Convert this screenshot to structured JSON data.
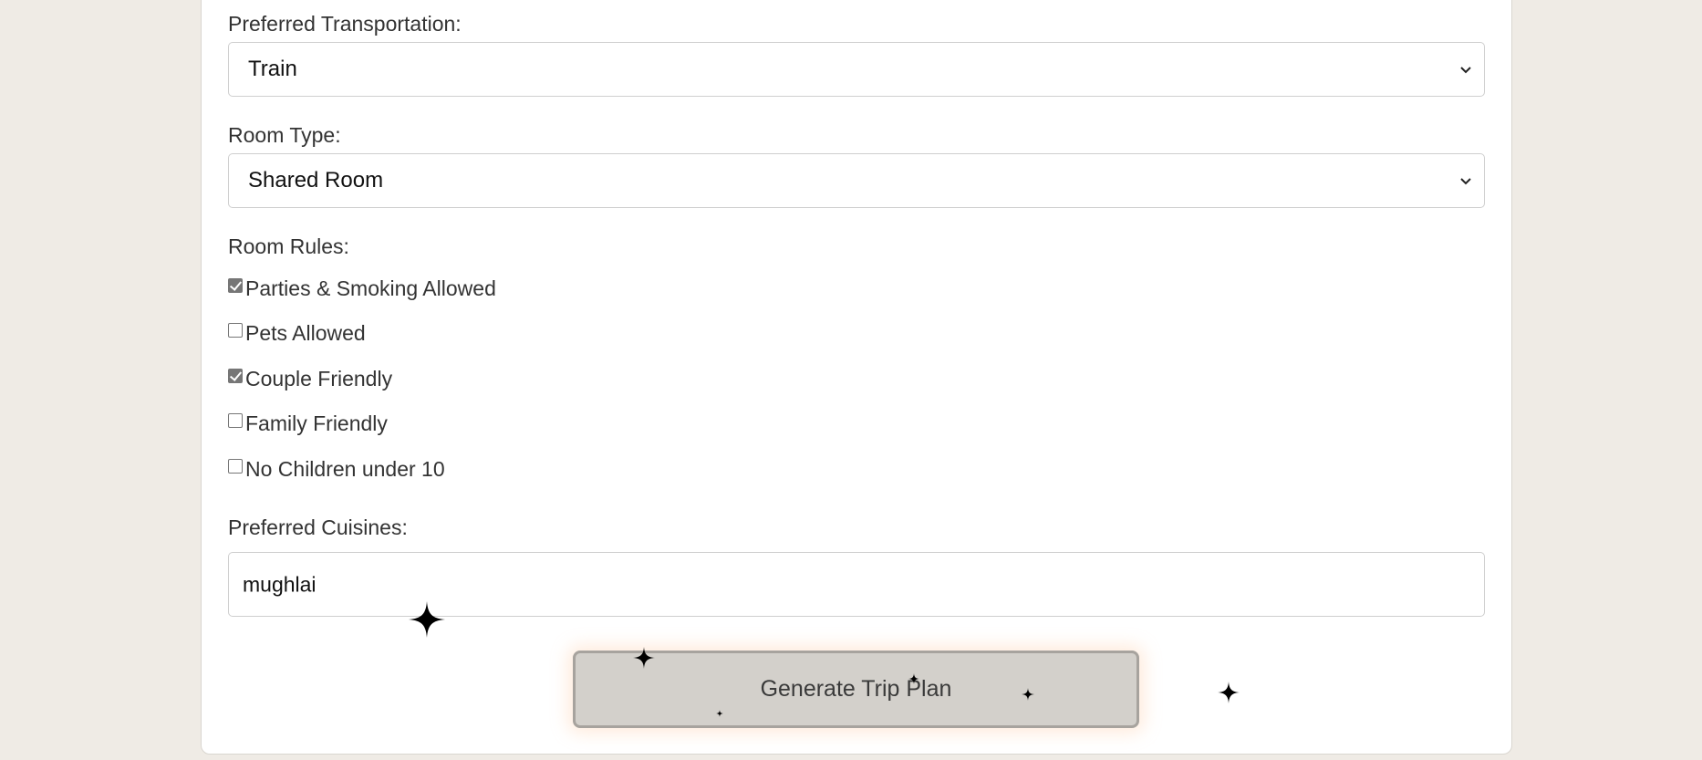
{
  "form": {
    "transportation": {
      "label": "Preferred Transportation:",
      "value": "Train"
    },
    "room_type": {
      "label": "Room Type:",
      "value": "Shared Room"
    },
    "room_rules": {
      "label": "Room Rules:",
      "items": [
        {
          "label": "Parties & Smoking Allowed",
          "checked": true
        },
        {
          "label": "Pets Allowed",
          "checked": false
        },
        {
          "label": "Couple Friendly",
          "checked": true
        },
        {
          "label": "Family Friendly",
          "checked": false
        },
        {
          "label": "No Children under 10",
          "checked": false
        }
      ]
    },
    "cuisines": {
      "label": "Preferred Cuisines:",
      "value": "mughlai"
    },
    "submit_label": "Generate Trip Plan"
  },
  "colors": {
    "page_background": "#efebe5",
    "card_background": "#ffffff",
    "button_background": "#d3d0cb",
    "button_border": "#a7a39e",
    "checkbox_checked": "#767676"
  },
  "icons": {
    "select_chevron": "chevron-down-icon",
    "sparkle": "sparkle-icon"
  }
}
